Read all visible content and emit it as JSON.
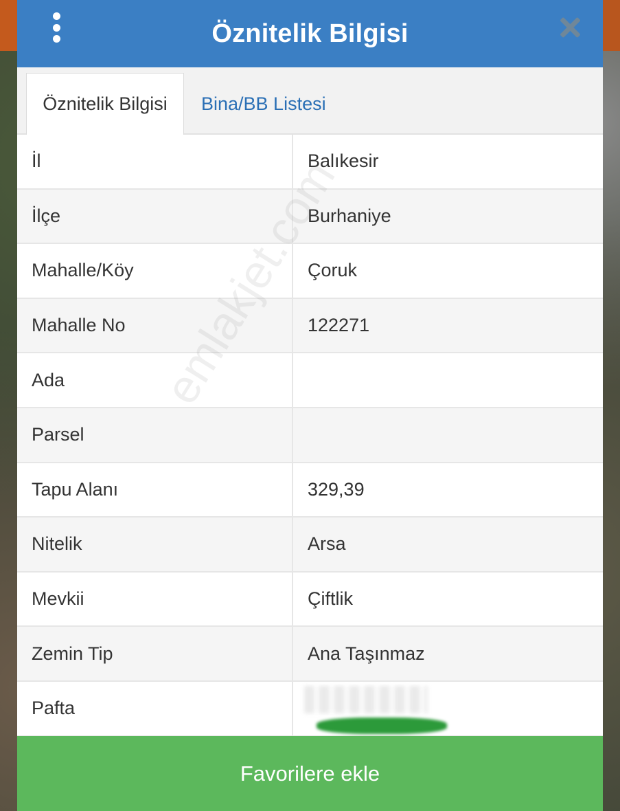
{
  "header": {
    "title": "Öznitelik Bilgisi",
    "menu_icon": "more-vertical-icon",
    "close_icon": "close-icon"
  },
  "tabs": [
    {
      "label": "Öznitelik Bilgisi",
      "active": true
    },
    {
      "label": "Bina/BB Listesi",
      "active": false
    }
  ],
  "rows": [
    {
      "key": "İl",
      "value": "Balıkesir"
    },
    {
      "key": "İlçe",
      "value": "Burhaniye"
    },
    {
      "key": "Mahalle/Köy",
      "value": "Çoruk"
    },
    {
      "key": "Mahalle No",
      "value": "122271"
    },
    {
      "key": "Ada",
      "value": ""
    },
    {
      "key": "Parsel",
      "value": ""
    },
    {
      "key": "Tapu Alanı",
      "value": "329,39"
    },
    {
      "key": "Nitelik",
      "value": "Arsa"
    },
    {
      "key": "Mevkii",
      "value": "Çiftlik"
    },
    {
      "key": "Zemin Tip",
      "value": "Ana Taşınmaz"
    },
    {
      "key": "Pafta",
      "value": ""
    }
  ],
  "footer": {
    "favorite_label": "Favorilere ekle"
  },
  "watermark": "emlakjet.com",
  "colors": {
    "header": "#3b7fc4",
    "tab_link": "#2a6fb5",
    "favorite_button": "#5cb85c"
  }
}
